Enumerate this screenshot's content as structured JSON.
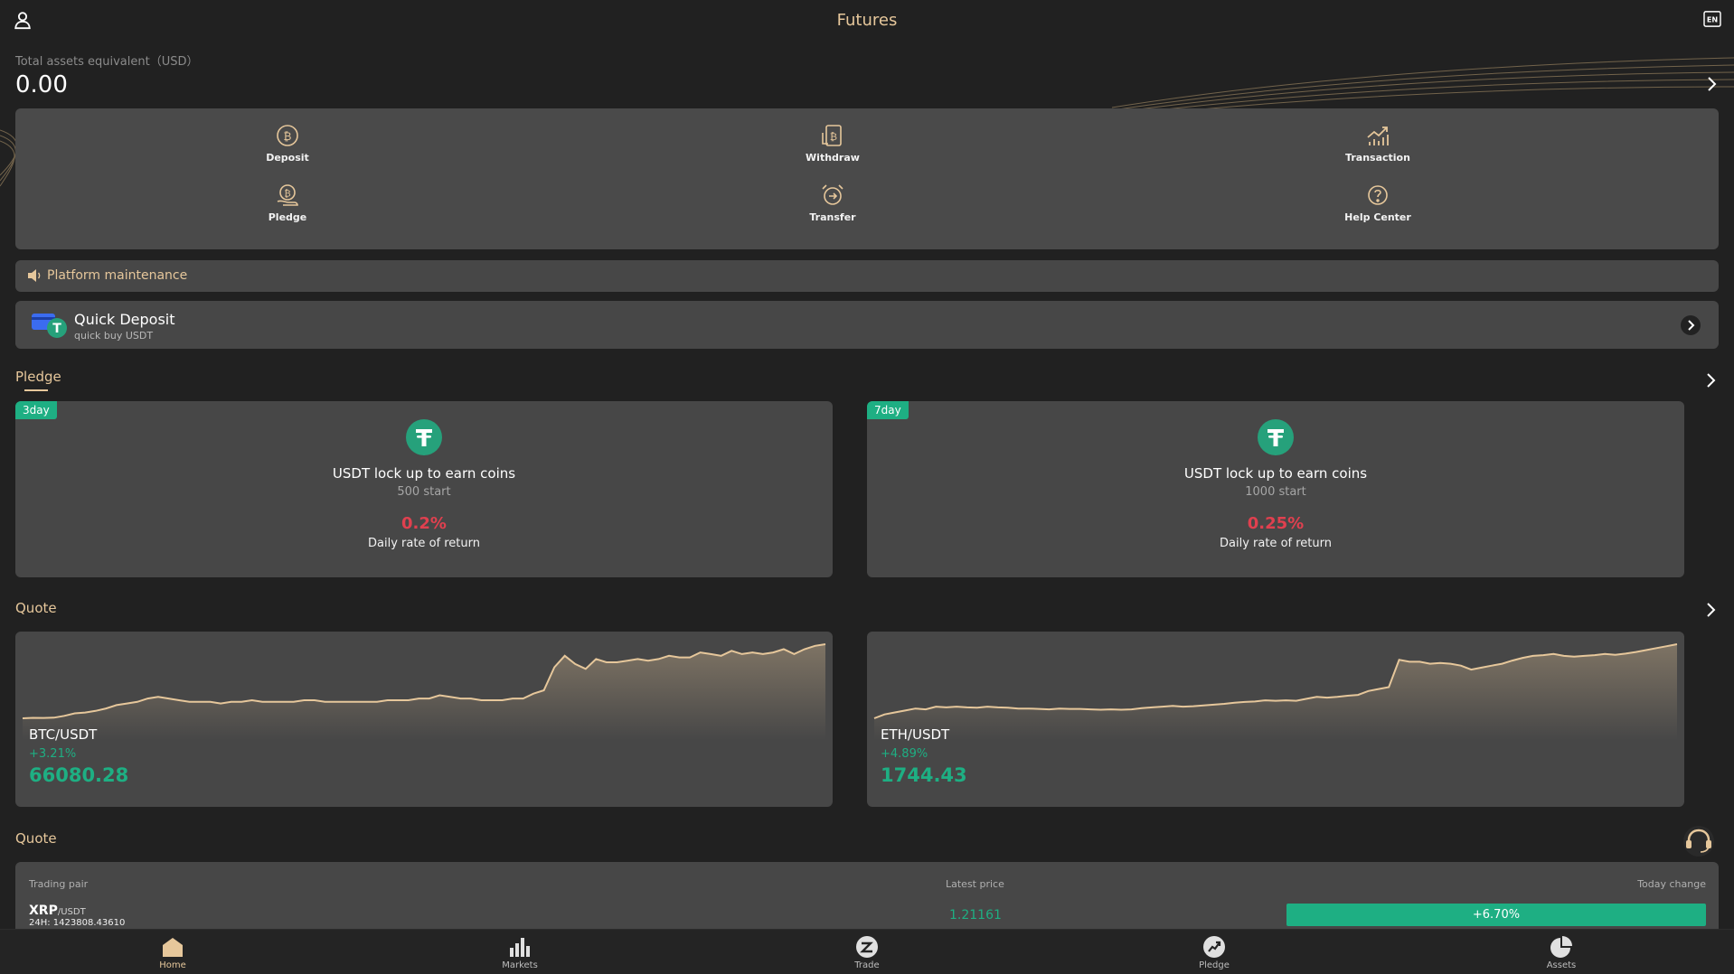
{
  "header": {
    "title": "Futures",
    "user_icon": "user-icon",
    "language_icon": "language-icon"
  },
  "assets": {
    "label": "Total assets equivalent（USD）",
    "value": "0.00"
  },
  "actions": [
    {
      "label": "Deposit",
      "icon": "deposit-icon"
    },
    {
      "label": "Withdraw",
      "icon": "withdraw-icon"
    },
    {
      "label": "Transaction",
      "icon": "transaction-icon"
    },
    {
      "label": "Pledge",
      "icon": "pledge-icon"
    },
    {
      "label": "Transfer",
      "icon": "transfer-icon"
    },
    {
      "label": "Help Center",
      "icon": "help-icon"
    }
  ],
  "notice": {
    "text": "Platform maintenance",
    "icon": "speaker-icon"
  },
  "quick_deposit": {
    "title": "Quick Deposit",
    "subtitle": "quick buy USDT"
  },
  "pledge": {
    "section_title": "Pledge",
    "cards": [
      {
        "badge": "3day",
        "heading": "USDT lock up to earn coins",
        "start": "500 start",
        "rate": "0.2%",
        "rate_label": "Daily rate of return"
      },
      {
        "badge": "7day",
        "heading": "USDT lock up to earn coins",
        "start": "1000 start",
        "rate": "0.25%",
        "rate_label": "Daily rate of return"
      }
    ]
  },
  "quote": {
    "section_title": "Quote",
    "cards": [
      {
        "pair": "BTC/USDT",
        "change": "+3.21%",
        "price": "66080.28"
      },
      {
        "pair": "ETH/USDT",
        "change": "+4.89%",
        "price": "1744.43"
      }
    ]
  },
  "chart_data": [
    {
      "type": "line",
      "series": [
        {
          "values": [
            2,
            2.3,
            2.2,
            2.4,
            3.5,
            5,
            5.5,
            6.5,
            8,
            10,
            11,
            12,
            14,
            15,
            14,
            13,
            12,
            12,
            12,
            11,
            12,
            12,
            13,
            12,
            12,
            12,
            12,
            13,
            13,
            12,
            12,
            12,
            12,
            12,
            12,
            13,
            13,
            13,
            14,
            14,
            16,
            15,
            14,
            14,
            13,
            13,
            13,
            14,
            14,
            17,
            19,
            33,
            40,
            35,
            32,
            38,
            36,
            36,
            37,
            38,
            37,
            38,
            40,
            39,
            39,
            42,
            41,
            40,
            43,
            41,
            42,
            41,
            42,
            44,
            41,
            44,
            46,
            47
          ]
        }
      ]
    },
    {
      "type": "line",
      "series": [
        {
          "values": [
            2,
            3,
            3.5,
            4,
            4.5,
            4.3,
            5,
            4.8,
            5,
            4.8,
            4.7,
            5,
            4.8,
            4.7,
            4.5,
            4.5,
            4.4,
            4.3,
            4.5,
            4.4,
            4.4,
            4.3,
            4.2,
            4.3,
            4.2,
            4.3,
            4.6,
            4.8,
            5,
            5.2,
            5,
            5.1,
            5.3,
            5.5,
            5.7,
            6,
            6.2,
            6.3,
            6.6,
            6.5,
            6.6,
            6.5,
            7,
            7.5,
            7.3,
            7.5,
            7.8,
            8,
            9,
            9.5,
            10,
            17,
            16.5,
            16.5,
            16,
            16.2,
            16,
            15.5,
            14.5,
            15,
            15.5,
            16,
            16.8,
            17.5,
            18,
            18.2,
            18.5,
            18,
            17.8,
            18,
            18.2,
            18.5,
            18.3,
            18.6,
            19,
            19.5,
            20,
            20.5,
            21
          ]
        }
      ]
    }
  ],
  "table": {
    "section_title": "Quote",
    "headers": {
      "pair": "Trading pair",
      "price": "Latest price",
      "change": "Today change"
    },
    "rows": [
      {
        "base": "XRP",
        "quote": "/USDT",
        "volume": "24H: 1423808.43610",
        "price": "1.21161",
        "change": "+6.70%"
      }
    ]
  },
  "nav": [
    {
      "label": "Home",
      "icon": "home-icon",
      "active": true
    },
    {
      "label": "Markets",
      "icon": "markets-icon",
      "active": false
    },
    {
      "label": "Trade",
      "icon": "trade-icon",
      "active": false
    },
    {
      "label": "Pledge",
      "icon": "pledge-nav-icon",
      "active": false
    },
    {
      "label": "Assets",
      "icon": "assets-pie-icon",
      "active": false
    }
  ],
  "colors": {
    "background": "#212121",
    "panel": "#474747",
    "accent_gold": "#e6c79b",
    "up_green": "#1eaf83",
    "rate_red": "#e0404f"
  }
}
